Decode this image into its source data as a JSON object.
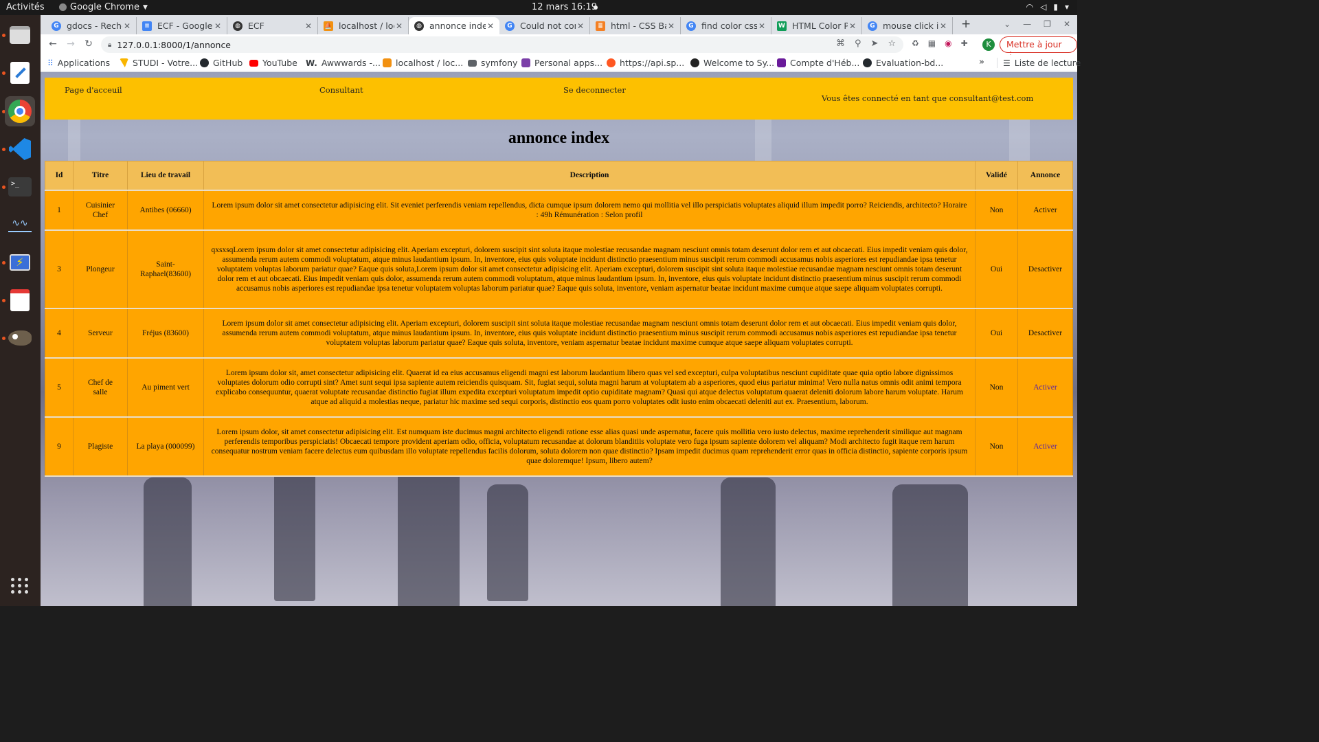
{
  "topbar": {
    "activities": "Activités",
    "app": "Google Chrome",
    "clock": "12 mars  16:19"
  },
  "tabs": [
    {
      "title": "gdocs - Recher",
      "color": "#4285f4"
    },
    {
      "title": "ECF - Google D",
      "color": "#4285f4"
    },
    {
      "title": "ECF",
      "color": "#333333"
    },
    {
      "title": "localhost / loc",
      "color": "#f29111"
    },
    {
      "title": "annonce index",
      "color": "#333333"
    },
    {
      "title": "Could not con",
      "color": "#4285f4"
    },
    {
      "title": "html - CSS Bac",
      "color": "#f48024"
    },
    {
      "title": "find color css",
      "color": "#4285f4"
    },
    {
      "title": "HTML Color Pi",
      "color": "#0f9d58"
    },
    {
      "title": "mouse click ic",
      "color": "#4285f4"
    }
  ],
  "address": {
    "url": "127.0.0.1:8000/1/annonce"
  },
  "profile": {
    "initial": "K"
  },
  "update_button": "Mettre à jour",
  "bookmarks": [
    {
      "label": "Applications",
      "color": "#4285f4"
    },
    {
      "label": "STUDI - Votre...",
      "color": "#f9b500"
    },
    {
      "label": "GitHub",
      "color": "#24292e"
    },
    {
      "label": "YouTube",
      "color": "#ff0000"
    },
    {
      "label": "Awwwards -...",
      "color": "#222222"
    },
    {
      "label": "localhost / loc...",
      "color": "#f29111"
    },
    {
      "label": "symfony",
      "color": "#5f6368"
    },
    {
      "label": "Personal apps...",
      "color": "#7b3fa8"
    },
    {
      "label": "https://api.sp...",
      "color": "#ff5722"
    },
    {
      "label": "Welcome to Sy...",
      "color": "#222222"
    },
    {
      "label": "Compte d'Héb...",
      "color": "#6a1b9a"
    },
    {
      "label": "Evaluation-bd...",
      "color": "#24292e"
    }
  ],
  "reading_list": "Liste de lecture",
  "site": {
    "nav": {
      "home": "Page d'acceuil",
      "consultant": "Consultant",
      "logout": "Se deconnecter",
      "user": "Vous êtes connecté en tant que consultant@test.com"
    },
    "title": "annonce index",
    "columns": [
      "Id",
      "Titre",
      "Lieu de travail",
      "Description",
      "Validé",
      "Annonce"
    ],
    "rows": [
      {
        "id": "1",
        "titre": "Cuisinier Chef",
        "lieu": "Antibes (06660)",
        "description": "Lorem ipsum dolor sit amet consectetur adipisicing elit. Sit eveniet perferendis veniam repellendus, dicta cumque ipsum dolorem nemo qui mollitia vel illo perspiciatis voluptates aliquid illum impedit porro? Reiciendis, architecto? Horaire : 49h Rémunération : Selon profil",
        "valide": "Non",
        "action": "Activer"
      },
      {
        "id": "3",
        "titre": "Plongeur",
        "lieu": "Saint-Raphael(83600)",
        "description": "qxsxsqLorem ipsum dolor sit amet consectetur adipisicing elit. Aperiam excepturi, dolorem suscipit sint soluta itaque molestiae recusandae magnam nesciunt omnis totam deserunt dolor rem et aut obcaecati. Eius impedit veniam quis dolor, assumenda rerum autem commodi voluptatum, atque minus laudantium ipsum. In, inventore, eius quis voluptate incidunt distinctio praesentium minus suscipit rerum commodi accusamus nobis asperiores est repudiandae ipsa tenetur voluptatem voluptas laborum pariatur quae? Eaque quis soluta,Lorem ipsum dolor sit amet consectetur adipisicing elit. Aperiam excepturi, dolorem suscipit sint soluta itaque molestiae recusandae magnam nesciunt omnis totam deserunt dolor rem et aut obcaecati. Eius impedit veniam quis dolor, assumenda rerum autem commodi voluptatum, atque minus laudantium ipsum. In, inventore, eius quis voluptate incidunt distinctio praesentium minus suscipit rerum commodi accusamus nobis asperiores est repudiandae ipsa tenetur voluptatem voluptas laborum pariatur quae? Eaque quis soluta, inventore, veniam aspernatur beatae incidunt maxime cumque atque saepe aliquam voluptates corrupti.",
        "valide": "Oui",
        "action": "Desactiver"
      },
      {
        "id": "4",
        "titre": "Serveur",
        "lieu": "Fréjus (83600)",
        "description": "Lorem ipsum dolor sit amet consectetur adipisicing elit. Aperiam excepturi, dolorem suscipit sint soluta itaque molestiae recusandae magnam nesciunt omnis totam deserunt dolor rem et aut obcaecati. Eius impedit veniam quis dolor, assumenda rerum autem commodi voluptatum, atque minus laudantium ipsum. In, inventore, eius quis voluptate incidunt distinctio praesentium minus suscipit rerum commodi accusamus nobis asperiores est repudiandae ipsa tenetur voluptatem voluptas laborum pariatur quae? Eaque quis soluta, inventore, veniam aspernatur beatae incidunt maxime cumque atque saepe aliquam voluptates corrupti.",
        "valide": "Oui",
        "action": "Desactiver"
      },
      {
        "id": "5",
        "titre": "Chef de salle",
        "lieu": "Au piment vert",
        "description": "Lorem ipsum dolor sit, amet consectetur adipisicing elit. Quaerat id ea eius accusamus eligendi magni est laborum laudantium libero quas vel sed excepturi, culpa voluptatibus nesciunt cupiditate quae quia optio labore dignissimos voluptates dolorum odio corrupti sint? Amet sunt sequi ipsa sapiente autem reiciendis quisquam. Sit, fugiat sequi, soluta magni harum at voluptatem ab a asperiores, quod eius pariatur minima! Vero nulla natus omnis odit animi tempora explicabo consequuntur, quaerat voluptate recusandae distinctio fugiat illum expedita excepturi voluptatum impedit optio cupiditate magnam? Quasi qui atque delectus voluptatum quaerat deleniti dolorum labore harum voluptate. Harum atque ad aliquid a molestias neque, pariatur hic maxime sed sequi corporis, distinctio eos quam porro voluptates odit iusto enim obcaecati deleniti aut ex. Praesentium, laborum.",
        "valide": "Non",
        "action": "Activer"
      },
      {
        "id": "9",
        "titre": "Plagiste",
        "lieu": "La playa (000099)",
        "description": "Lorem ipsum dolor, sit amet consectetur adipisicing elit. Est numquam iste ducimus magni architecto eligendi ratione esse alias quasi unde aspernatur, facere quis mollitia vero iusto delectus, maxime reprehenderit similique aut magnam perferendis temporibus perspiciatis! Obcaecati tempore provident aperiam odio, officia, voluptatum recusandae at dolorum blanditiis voluptate vero fuga ipsum sapiente dolorem vel aliquam? Modi architecto fugit itaque rem harum consequatur nostrum veniam facere delectus eum quibusdam illo voluptate repellendus facilis dolorum, soluta dolorem non quae distinctio? Ipsam impedit ducimus quam reprehenderit error quas in officia distinctio, sapiente corporis ipsum quae doloremque! Ipsum, libero autem?",
        "valide": "Non",
        "action": "Activer"
      }
    ]
  }
}
